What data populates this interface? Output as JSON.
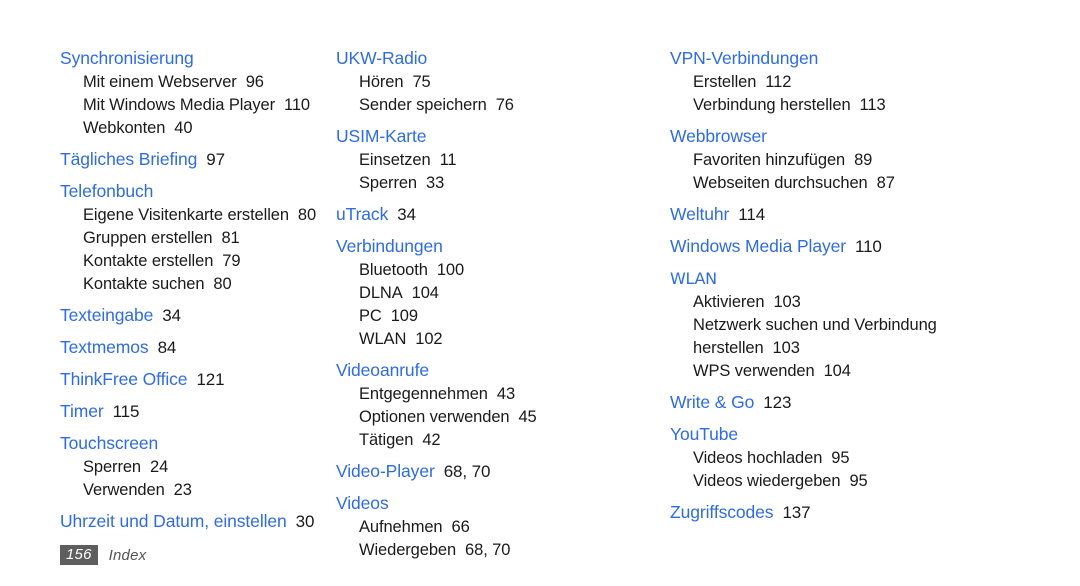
{
  "page": {
    "footer_page_number": "156",
    "footer_label": "Index",
    "heading_color": "#2f6ce0",
    "text_color": "#1a1a1a",
    "footer_box_color": "#5e5e5e"
  },
  "columns": [
    {
      "name": "column-1",
      "groups": [
        {
          "heading": "Synchronisierung",
          "heading_page": "",
          "subs": [
            {
              "label": "Mit einem Webserver",
              "page": "96"
            },
            {
              "label": "Mit Windows Media Player",
              "page": "110"
            },
            {
              "label": "Webkonten",
              "page": "40"
            }
          ]
        },
        {
          "heading": "Tägliches Briefing",
          "heading_page": "97",
          "subs": []
        },
        {
          "heading": "Telefonbuch",
          "heading_page": "",
          "subs": [
            {
              "label": "Eigene Visitenkarte erstellen",
              "page": "80"
            },
            {
              "label": "Gruppen erstellen",
              "page": "81"
            },
            {
              "label": "Kontakte erstellen",
              "page": "79"
            },
            {
              "label": "Kontakte suchen",
              "page": "80"
            }
          ]
        },
        {
          "heading": "Texteingabe",
          "heading_page": "34",
          "subs": []
        },
        {
          "heading": "Textmemos",
          "heading_page": "84",
          "subs": []
        },
        {
          "heading": "ThinkFree Office",
          "heading_page": "121",
          "subs": []
        },
        {
          "heading": "Timer",
          "heading_page": "115",
          "subs": []
        },
        {
          "heading": "Touchscreen",
          "heading_page": "",
          "subs": [
            {
              "label": "Sperren",
              "page": "24"
            },
            {
              "label": "Verwenden",
              "page": "23"
            }
          ]
        },
        {
          "heading": "Uhrzeit und Datum, einstellen",
          "heading_page": "30",
          "subs": []
        }
      ]
    },
    {
      "name": "column-2",
      "groups": [
        {
          "heading": "UKW-Radio",
          "heading_page": "",
          "subs": [
            {
              "label": "Hören",
              "page": "75"
            },
            {
              "label": "Sender speichern",
              "page": "76"
            }
          ]
        },
        {
          "heading": "USIM-Karte",
          "heading_page": "",
          "subs": [
            {
              "label": "Einsetzen",
              "page": "11"
            },
            {
              "label": "Sperren",
              "page": "33"
            }
          ]
        },
        {
          "heading": "uTrack",
          "heading_page": "34",
          "subs": []
        },
        {
          "heading": "Verbindungen",
          "heading_page": "",
          "subs": [
            {
              "label": "Bluetooth",
              "page": "100"
            },
            {
              "label": "DLNA",
              "page": "104"
            },
            {
              "label": "PC",
              "page": "109"
            },
            {
              "label": "WLAN",
              "page": "102"
            }
          ]
        },
        {
          "heading": "Videoanrufe",
          "heading_page": "",
          "subs": [
            {
              "label": "Entgegennehmen",
              "page": "43"
            },
            {
              "label": "Optionen verwenden",
              "page": "45"
            },
            {
              "label": "Tätigen",
              "page": "42"
            }
          ]
        },
        {
          "heading": "Video-Player",
          "heading_page": "68, 70",
          "subs": []
        },
        {
          "heading": "Videos",
          "heading_page": "",
          "subs": [
            {
              "label": "Aufnehmen",
              "page": "66"
            },
            {
              "label": "Wiedergeben",
              "page": "68, 70"
            }
          ]
        }
      ]
    },
    {
      "name": "column-3",
      "groups": [
        {
          "heading": "VPN-Verbindungen",
          "heading_page": "",
          "subs": [
            {
              "label": "Erstellen",
              "page": "112"
            },
            {
              "label": "Verbindung herstellen",
              "page": "113"
            }
          ]
        },
        {
          "heading": "Webbrowser",
          "heading_page": "",
          "subs": [
            {
              "label": "Favoriten hinzufügen",
              "page": "89"
            },
            {
              "label": "Webseiten durchsuchen",
              "page": "87"
            }
          ]
        },
        {
          "heading": "Weltuhr",
          "heading_page": "114",
          "subs": []
        },
        {
          "heading": "Windows Media Player",
          "heading_page": "110",
          "subs": []
        },
        {
          "heading": "WLAN",
          "heading_page": "",
          "alt_face": true,
          "subs": [
            {
              "label": "Aktivieren",
              "page": "103"
            },
            {
              "label": "Netzwerk suchen und Verbindung",
              "page": ""
            },
            {
              "label": "herstellen",
              "page": "103"
            },
            {
              "label": "WPS verwenden",
              "page": "104"
            }
          ]
        },
        {
          "heading": "Write & Go",
          "heading_page": "123",
          "subs": []
        },
        {
          "heading": "YouTube",
          "heading_page": "",
          "subs": [
            {
              "label": "Videos hochladen",
              "page": "95"
            },
            {
              "label": "Videos wiedergeben",
              "page": "95"
            }
          ]
        },
        {
          "heading": "Zugriffscodes",
          "heading_page": "137",
          "subs": []
        }
      ]
    }
  ]
}
